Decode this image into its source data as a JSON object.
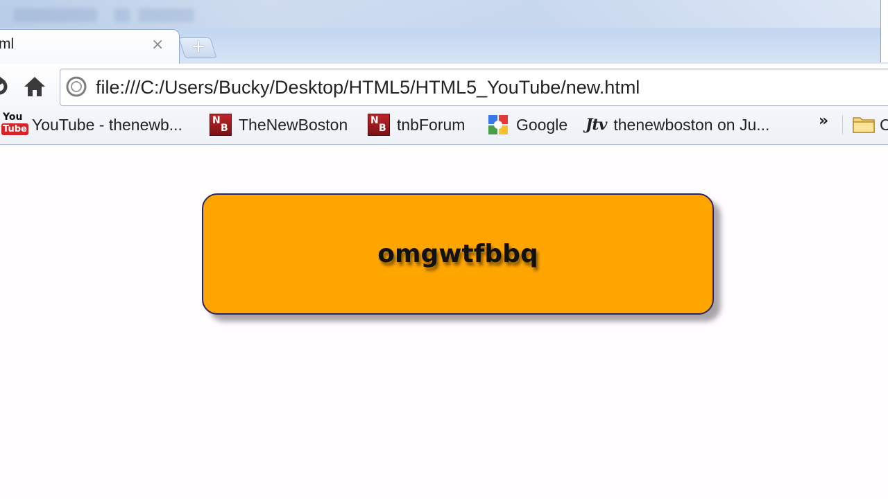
{
  "browser": {
    "tab": {
      "title": "ml",
      "close_glyph": "×"
    },
    "new_tab_glyph": "+",
    "toolbar": {
      "reload_icon": "reload-icon",
      "home_icon": "home-icon"
    },
    "omnibox": {
      "icon": "globe-icon",
      "url": "file:///C:/Users/Bucky/Desktop/HTML5/HTML5_YouTube/new.html"
    },
    "bookmarks": {
      "items": [
        {
          "label": "YouTube - thenewb...",
          "icon": "youtube-icon"
        },
        {
          "label": "TheNewBoston",
          "icon": "thenewboston-icon"
        },
        {
          "label": "tnbForum",
          "icon": "thenewboston-icon"
        },
        {
          "label": "Google",
          "icon": "google-icon"
        },
        {
          "label": "thenewboston on Ju...",
          "icon": "justintv-icon"
        }
      ],
      "overflow_glyph": "»",
      "folder_label": "C",
      "folder_icon": "folder-icon"
    }
  },
  "page": {
    "box_text": "omgwtfbbq",
    "colors": {
      "box_fill": "#ffa500",
      "box_border": "#2b2466",
      "page_background": "#fffdff"
    }
  }
}
